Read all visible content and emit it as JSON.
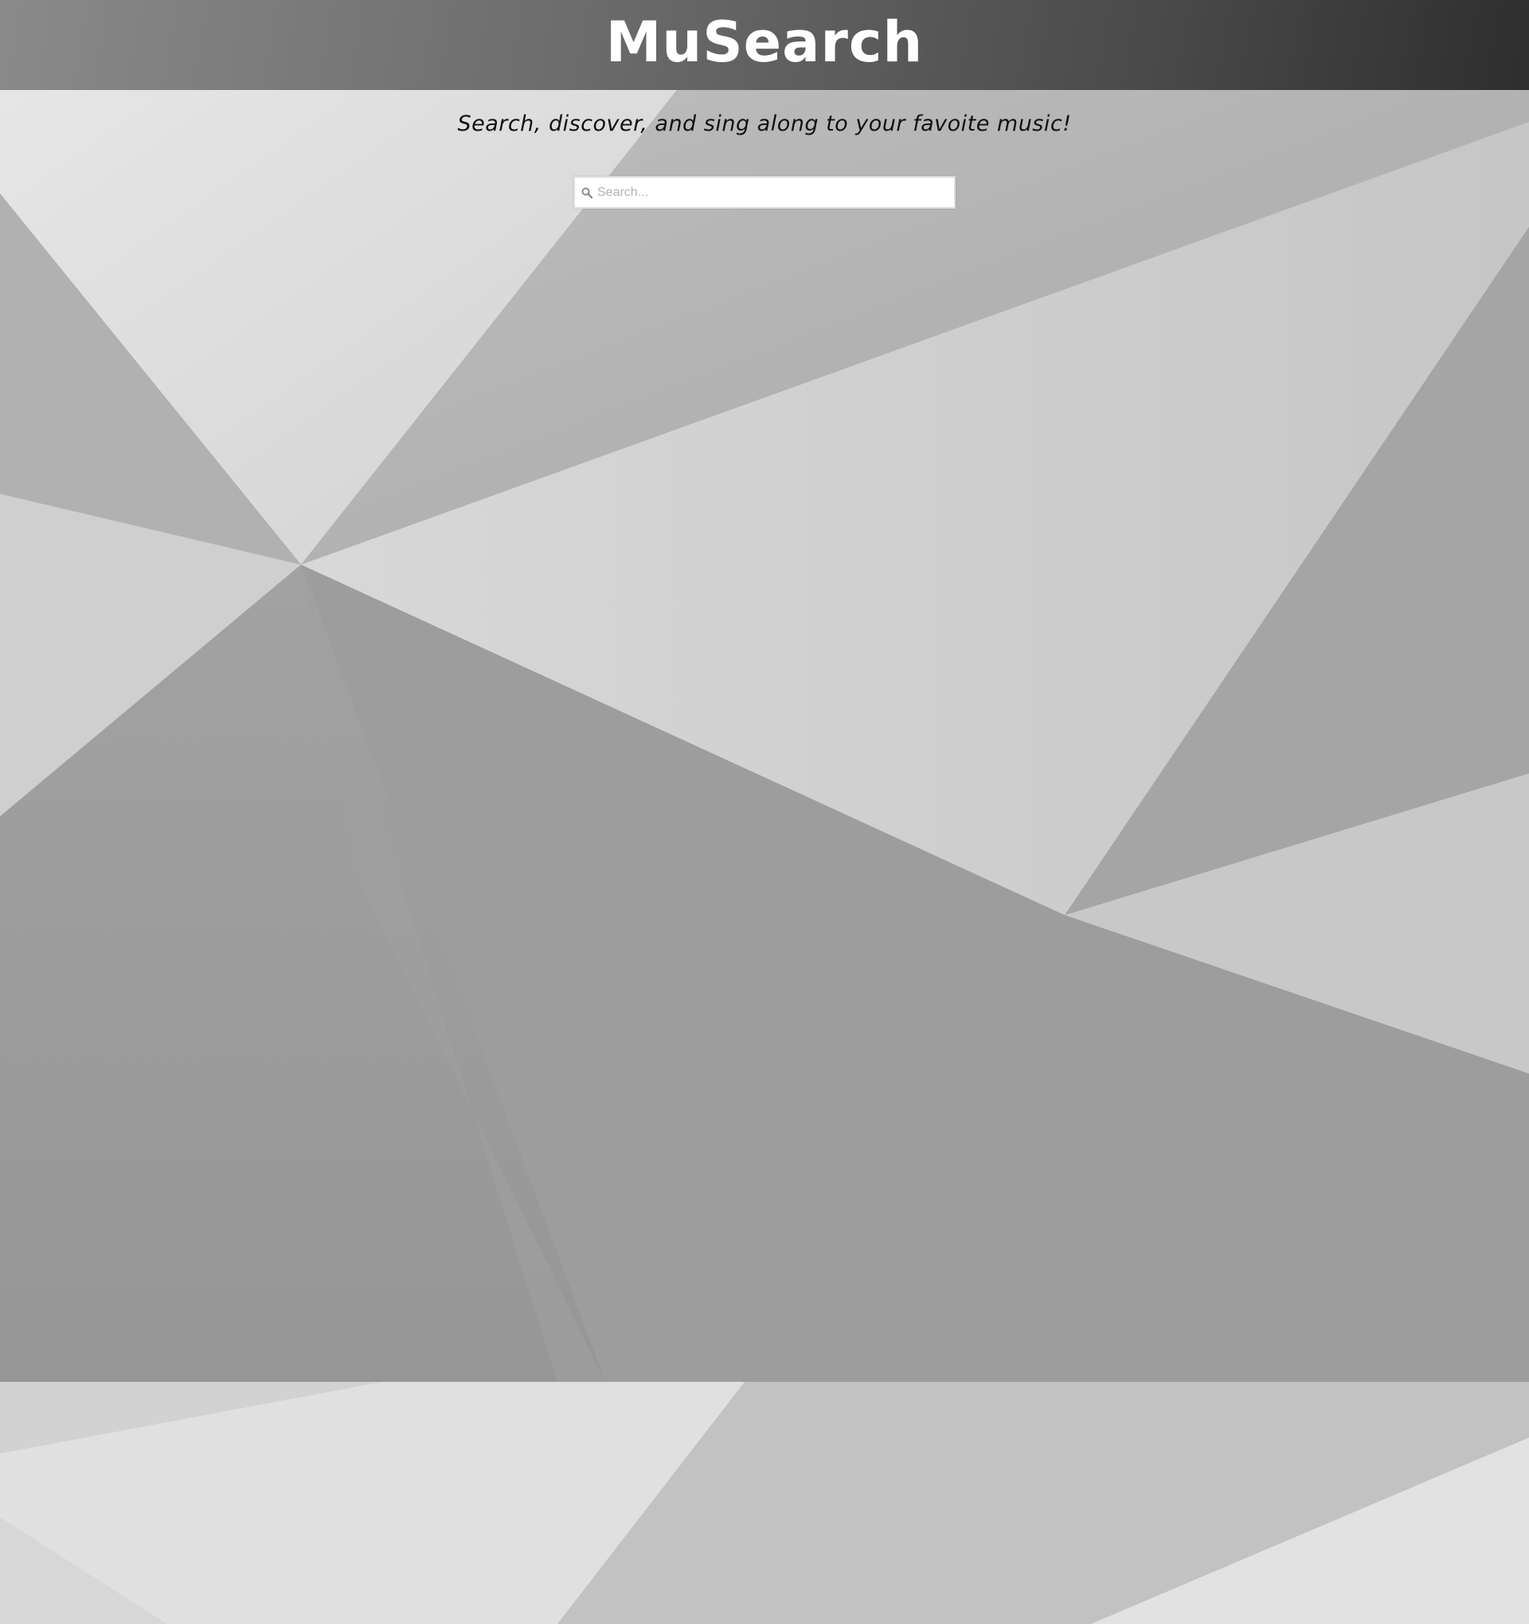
{
  "header": {
    "logo_text": "MuSearch"
  },
  "hero": {
    "tagline": "Search, discover, and sing along to your favoite music!"
  },
  "search": {
    "placeholder": "Search...",
    "value": "",
    "icon": "search-icon"
  },
  "colors": {
    "header_dark": "#2e2e2e",
    "header_light": "#8a8a8a",
    "background_gray": "#9a9a9a",
    "logo_text": "#ffffff",
    "tagline_text": "#111111"
  }
}
